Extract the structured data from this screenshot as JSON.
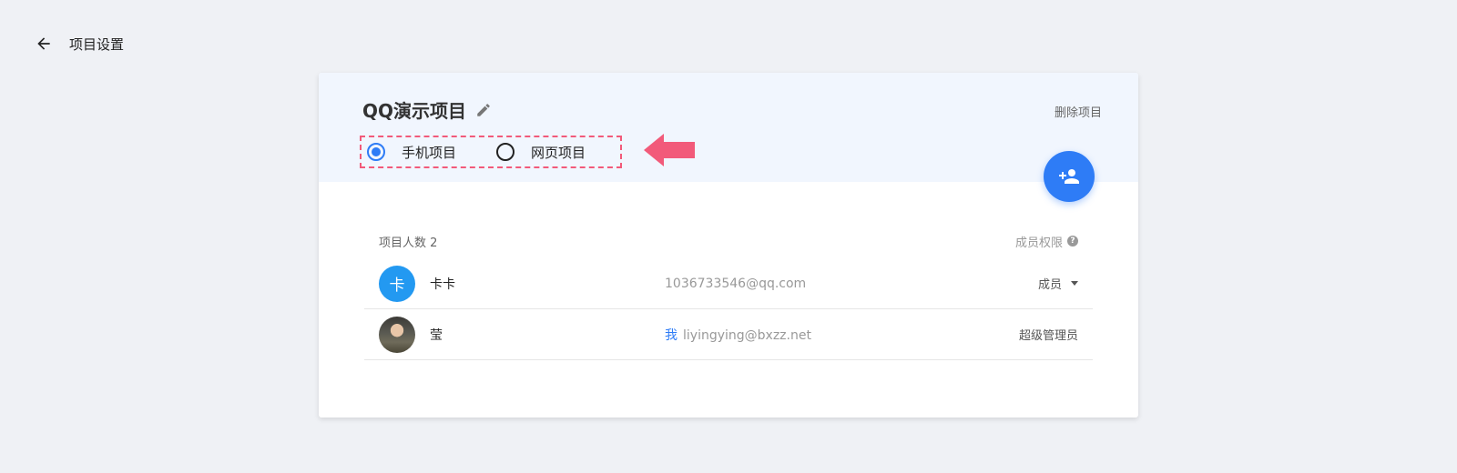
{
  "header": {
    "title": "项目设置",
    "back_icon": "arrow-left-icon"
  },
  "project": {
    "name": "QQ演示项目",
    "delete_label": "删除项目",
    "type_options": [
      {
        "label": "手机项目",
        "selected": true
      },
      {
        "label": "网页项目",
        "selected": false
      }
    ]
  },
  "members": {
    "count_label": "项目人数 2",
    "permission_label": "成员权限",
    "list": [
      {
        "avatar_text": "卡",
        "name": "卡卡",
        "me_tag": "",
        "email": "1036733546@qq.com",
        "role": "成员"
      },
      {
        "avatar_text": "",
        "name": "莹",
        "me_tag": "我",
        "email": "liyingying@bxzz.net",
        "role": "超级管理员"
      }
    ]
  },
  "colors": {
    "accent": "#2e7cf6",
    "head_bg": "#f1f6fe",
    "annotation": "#f25a7a",
    "avatar_bg": "#2399f1"
  }
}
